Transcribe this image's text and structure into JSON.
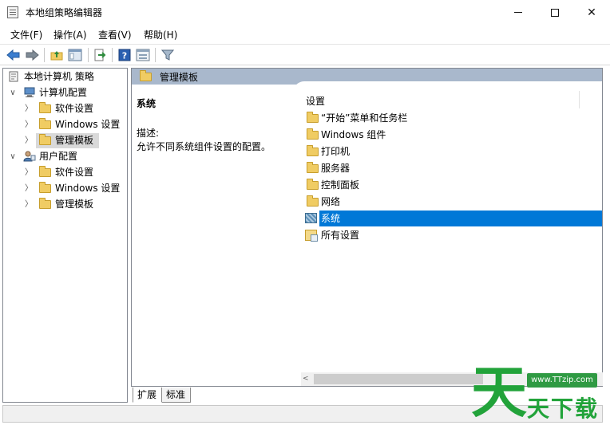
{
  "window": {
    "title": "本地组策略编辑器",
    "min_glyph": "",
    "max_glyph": "",
    "close_glyph": "✕"
  },
  "menu": [
    "文件(F)",
    "操作(A)",
    "查看(V)",
    "帮助(H)"
  ],
  "toolbar": {
    "icons": [
      "back-arrow-icon",
      "forward-arrow-icon",
      "folder-up-icon",
      "show-hide-tree-icon",
      "export-list-icon",
      "help-icon",
      "properties-icon",
      "filter-icon"
    ]
  },
  "tree": [
    {
      "label": "本地计算机 策略",
      "expander": ""
    },
    {
      "label": "计算机配置",
      "expander": "∨"
    },
    {
      "label": "软件设置",
      "expander": "〉"
    },
    {
      "label": "Windows 设置",
      "expander": "〉"
    },
    {
      "label": "管理模板",
      "expander": "〉",
      "selected": true
    },
    {
      "label": "用户配置",
      "expander": "∨"
    },
    {
      "label": "软件设置",
      "expander": "〉"
    },
    {
      "label": "Windows 设置",
      "expander": "〉"
    },
    {
      "label": "管理模板",
      "expander": "〉"
    }
  ],
  "right": {
    "header_title": "管理模板",
    "desc_title": "系统",
    "desc_label": "描述:",
    "desc_text": "允许不同系统组件设置的配置。",
    "column_header": "设置",
    "items": [
      {
        "label": "“开始”菜单和任务栏",
        "icon": "folder"
      },
      {
        "label": "Windows 组件",
        "icon": "folder"
      },
      {
        "label": "打印机",
        "icon": "folder"
      },
      {
        "label": "服务器",
        "icon": "folder"
      },
      {
        "label": "控制面板",
        "icon": "folder"
      },
      {
        "label": "网络",
        "icon": "folder"
      },
      {
        "label": "系统",
        "icon": "system",
        "selected": true
      },
      {
        "label": "所有设置",
        "icon": "all-settings"
      }
    ],
    "scroll_left_glyph": "<"
  },
  "tabs": [
    "扩展",
    "标准"
  ],
  "watermark": {
    "big": "天",
    "url": "www.TTzip.com",
    "tail": "天下载"
  },
  "colors": {
    "selection": "#0078d7",
    "header_band": "#a9b8cc",
    "tree_selection": "#d9d9d9",
    "watermark_green": "#22a33a"
  }
}
